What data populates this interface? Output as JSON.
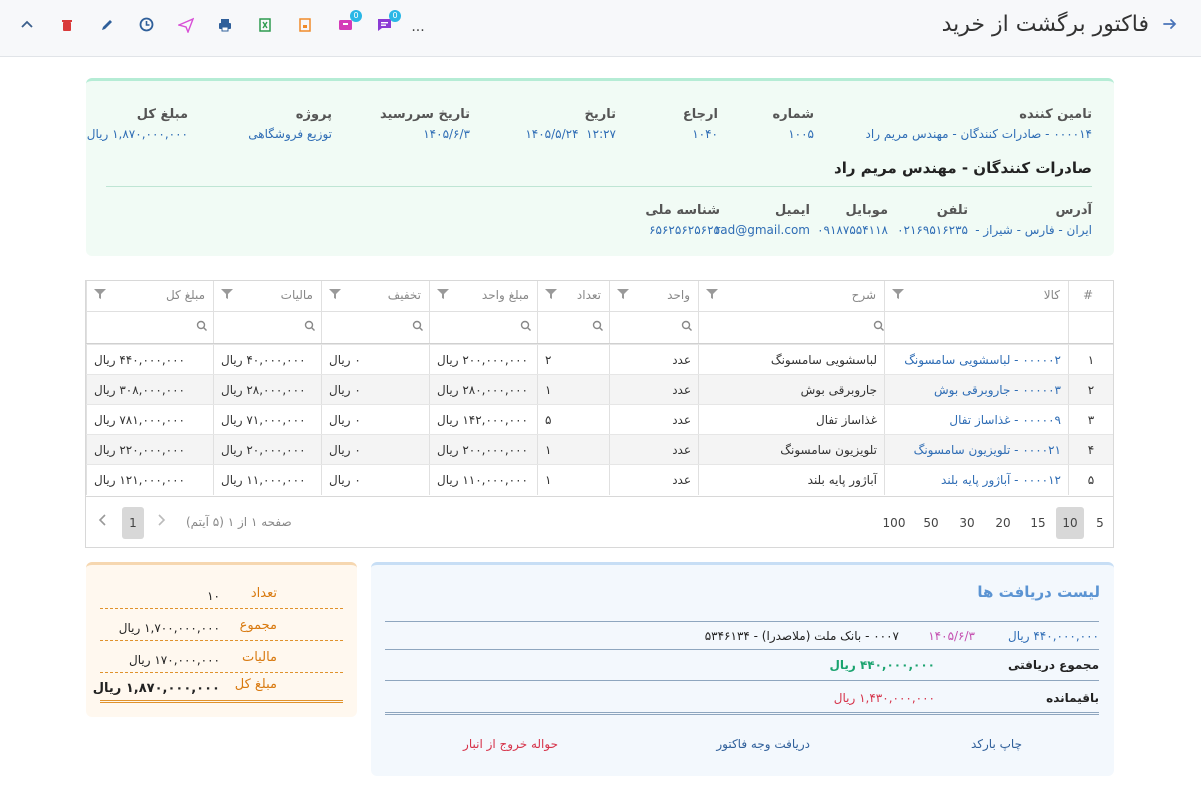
{
  "page": {
    "title": "فاکتور برگشت از خرید",
    "colors": {
      "accent": "#2f6db5",
      "orange": "#d97a10",
      "green": "#1aa36f",
      "red": "#d6334a"
    }
  },
  "toolbar": {
    "more_label": "...",
    "icons": [
      "chevron-up-icon",
      "trash-icon",
      "pencil-icon",
      "clock-icon",
      "send-icon",
      "print-icon",
      "excel-icon",
      "pdf-icon",
      "box-icon",
      "comment-icon"
    ],
    "badges": {
      "box": "0",
      "comment": "0"
    }
  },
  "header": {
    "supplier": {
      "label": "تامین کننده",
      "value": "۰۰۰۰۱۴ - صادرات کنندگان - مهندس مریم راد"
    },
    "number": {
      "label": "شماره",
      "value": "۱۰۰۵"
    },
    "reference": {
      "label": "ارجاع",
      "value": "۱۰۴۰"
    },
    "date": {
      "label": "تاریخ",
      "value": "۱۴۰۵/۵/۲۴",
      "time": "۱۲:۲۷"
    },
    "due_date": {
      "label": "تاریخ سررسید",
      "value": "۱۴۰۵/۶/۳"
    },
    "project": {
      "label": "پروژه",
      "value": "توزیع فروشگاهی"
    },
    "total": {
      "label": "مبلغ کل",
      "value": "۱,۸۷۰,۰۰۰,۰۰۰ ریال"
    },
    "supplier_name": "صادرات کنندگان - مهندس مریم راد",
    "address": {
      "label": "آدرس",
      "value": "ایران - فارس - شیراز -"
    },
    "phone": {
      "label": "تلفن",
      "value": "۰۲۱۶۹۵۱۶۲۳۵"
    },
    "mobile": {
      "label": "موبایل",
      "value": "۰۹۱۸۷۵۵۴۱۱۸"
    },
    "email": {
      "label": "ایمیل",
      "value": "rad@gmail.com"
    },
    "national_id": {
      "label": "شناسه ملی",
      "value": "۶۵۶۲۵۶۲۵۶۲۵"
    }
  },
  "grid": {
    "columns": {
      "index": "#",
      "item": "کالا",
      "description": "شرح",
      "unit": "واحد",
      "qty": "تعداد",
      "unit_price": "مبلغ واحد",
      "discount": "تخفیف",
      "tax": "مالیات",
      "total": "مبلغ کل"
    },
    "rows": [
      {
        "index": "۱",
        "item": "۰۰۰۰۰۲ - لباسشویی سامسونگ",
        "description": "لباسشویی سامسونگ",
        "unit": "عدد",
        "qty": "۲",
        "unit_price": "۲۰۰,۰۰۰,۰۰۰ ریال",
        "discount": "۰ ریال",
        "tax": "۴۰,۰۰۰,۰۰۰ ریال",
        "total": "۴۴۰,۰۰۰,۰۰۰ ریال"
      },
      {
        "index": "۲",
        "item": "۰۰۰۰۰۳ - جاروبرقی بوش",
        "description": "جاروبرقی بوش",
        "unit": "عدد",
        "qty": "۱",
        "unit_price": "۲۸۰,۰۰۰,۰۰۰ ریال",
        "discount": "۰ ریال",
        "tax": "۲۸,۰۰۰,۰۰۰ ریال",
        "total": "۳۰۸,۰۰۰,۰۰۰ ریال"
      },
      {
        "index": "۳",
        "item": "۰۰۰۰۰۹ - غذاساز تفال",
        "description": "غذاساز تفال",
        "unit": "عدد",
        "qty": "۵",
        "unit_price": "۱۴۲,۰۰۰,۰۰۰ ریال",
        "discount": "۰ ریال",
        "tax": "۷۱,۰۰۰,۰۰۰ ریال",
        "total": "۷۸۱,۰۰۰,۰۰۰ ریال"
      },
      {
        "index": "۴",
        "item": "۰۰۰۰۲۱ - تلویزیون سامسونگ",
        "description": "تلویزیون سامسونگ",
        "unit": "عدد",
        "qty": "۱",
        "unit_price": "۲۰۰,۰۰۰,۰۰۰ ریال",
        "discount": "۰ ریال",
        "tax": "۲۰,۰۰۰,۰۰۰ ریال",
        "total": "۲۲۰,۰۰۰,۰۰۰ ریال"
      },
      {
        "index": "۵",
        "item": "۰۰۰۰۱۲ - آباژور پایه بلند",
        "description": "آباژور پایه بلند",
        "unit": "عدد",
        "qty": "۱",
        "unit_price": "۱۱۰,۰۰۰,۰۰۰ ریال",
        "discount": "۰ ریال",
        "tax": "۱۱,۰۰۰,۰۰۰ ریال",
        "total": "۱۲۱,۰۰۰,۰۰۰ ریال"
      }
    ],
    "pager": {
      "page_sizes": [
        "5",
        "10",
        "15",
        "20",
        "30",
        "50",
        "100"
      ],
      "active_size": "10",
      "info": "صفحه ۱ از ۱ (۵ آیتم)",
      "current_page": "1"
    }
  },
  "totals": {
    "count": {
      "label": "تعداد",
      "value": "۱۰"
    },
    "subtotal": {
      "label": "مجموع",
      "value": "۱,۷۰۰,۰۰۰,۰۰۰ ریال"
    },
    "tax": {
      "label": "مالیات",
      "value": "۱۷۰,۰۰۰,۰۰۰ ریال"
    },
    "grand_total": {
      "label": "مبلغ کل",
      "value": "۱,۸۷۰,۰۰۰,۰۰۰ ریال"
    }
  },
  "receipts": {
    "title": "لیست دریافت ها",
    "items": [
      {
        "amount": "۴۴۰,۰۰۰,۰۰۰ ریال",
        "date": "۱۴۰۵/۶/۳",
        "account": "۰۰۰۷ - بانک ملت (ملاصدرا) - ۵۳۴۶۱۳۴"
      }
    ],
    "received_total": {
      "label": "مجموع دریافتی",
      "value": "۴۴۰,۰۰۰,۰۰۰ ریال"
    },
    "remaining": {
      "label": "باقیمانده",
      "value": "۱,۴۳۰,۰۰۰,۰۰۰ ریال"
    },
    "actions": {
      "print_barcode": "چاپ بارکد",
      "receive_payment": "دریافت وجه فاکتور",
      "warehouse_exit": "حواله خروج از انبار"
    }
  }
}
